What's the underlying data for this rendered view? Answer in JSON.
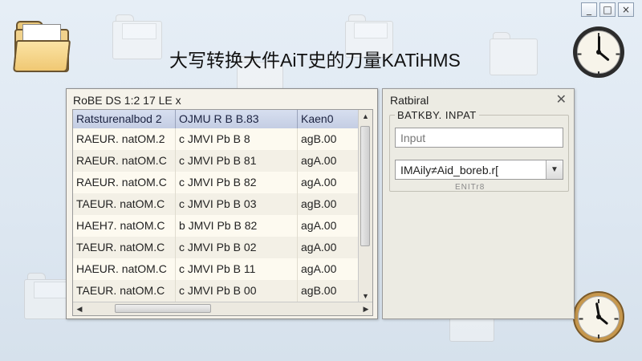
{
  "window_controls": {
    "minimize": "_",
    "maximize": "□",
    "close": "×"
  },
  "title": "大写转换大件AiT史的刀量KATiHMS",
  "list_window": {
    "title": "RoBE DS 1:2 17 LE x",
    "columns": [
      "Ratsturenalbod 2",
      "OJMU R B B.83",
      "Kaen0"
    ],
    "rows": [
      [
        "RAEUR. natOM.2",
        "c JMVI Pb B 8",
        "agB.00"
      ],
      [
        "RAEUR. natOM.C",
        "c JMVI Pb B 81",
        "agA.00"
      ],
      [
        "RAEUR. natOM.C",
        "c JMVI Pb B 82",
        "agA.00"
      ],
      [
        "TAEUR. natOM.C",
        "c JMVI Pb B 03",
        "agB.00"
      ],
      [
        "HAEH7. natOM.C",
        "b JMVI Pb B 82",
        "agA.00"
      ],
      [
        "TAEUR. natOM.C",
        "c JMVI Pb B 02",
        "agA.00"
      ],
      [
        "HAEUR. natOM.C",
        "c JMVI Pb B 11",
        "agA.00"
      ],
      [
        "TAEUR. natOM.C",
        "c JMVI Pb B 00",
        "agB.00"
      ]
    ],
    "scroll_up": "▲",
    "scroll_down": "▼",
    "scroll_left": "◀",
    "scroll_right": "▶"
  },
  "panel": {
    "title": "Ratbiral",
    "close": "✕",
    "group_label": "BATKBY. INPAT",
    "input_placeholder": "Input",
    "select_value": "IMAily≠Aid_boreb.r[",
    "select_arrow": "▼",
    "group_footer": "ENITr8"
  },
  "icons": {
    "folder": "folder-icon",
    "clock": "clock-icon"
  },
  "colors": {
    "header_row": "#c4cde3",
    "folder": "#f1d28c",
    "background": "#dde7f1"
  }
}
